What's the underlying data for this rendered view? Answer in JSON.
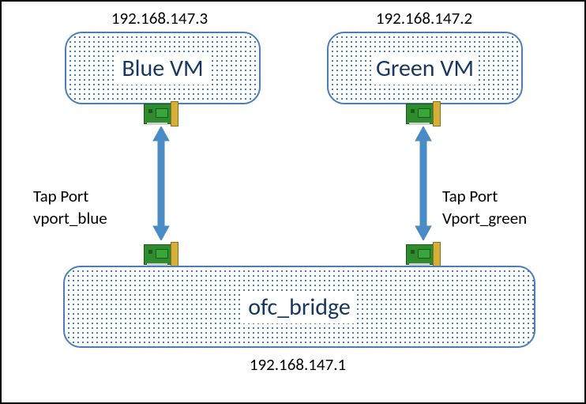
{
  "vm_blue": {
    "ip": "192.168.147.3",
    "label": "Blue VM"
  },
  "vm_green": {
    "ip": "192.168.147.2",
    "label": "Green VM"
  },
  "bridge": {
    "label": "ofc_bridge",
    "ip": "192.168.147.1"
  },
  "tap_blue": {
    "line1": "Tap Port",
    "line2": "vport_blue"
  },
  "tap_green": {
    "line1": "Tap Port",
    "line2": "Vport_green"
  }
}
